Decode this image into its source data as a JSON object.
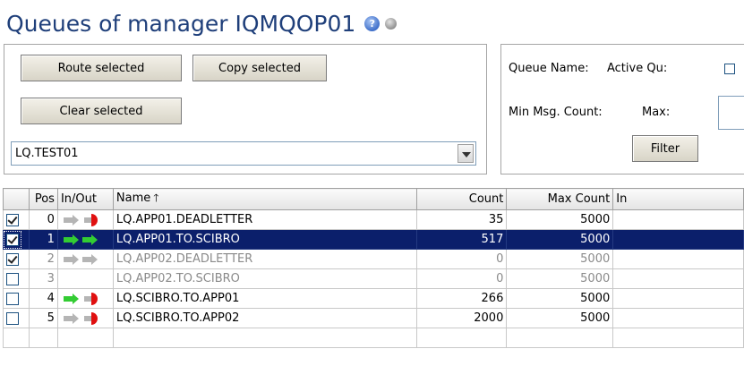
{
  "header": {
    "title": "Queues of manager IQMQOP01",
    "help_icon": "help-icon",
    "status_icon": "status-dot-icon"
  },
  "actions": {
    "route_label": "Route selected",
    "copy_label": "Copy selected",
    "clear_label": "Clear selected",
    "target_queue": "LQ.TEST01"
  },
  "filter": {
    "queue_name_label": "Queue Name:",
    "active_label": "Active Qu:",
    "min_count_label": "Min Msg. Count:",
    "max_label": "Max:",
    "filter_label": "Filter"
  },
  "table": {
    "columns": {
      "check": "",
      "pos": "Pos",
      "inout": "In/Out",
      "name": "Name",
      "count": "Count",
      "max_count": "Max Count",
      "extra": "In"
    },
    "rows": [
      {
        "checked": true,
        "pos": "0",
        "in_arrow": "gray",
        "out_arrow": "red",
        "name": "LQ.APP01.DEADLETTER",
        "count": "35",
        "max_count": "5000",
        "selected": false,
        "dim": false
      },
      {
        "checked": true,
        "pos": "1",
        "in_arrow": "green",
        "out_arrow": "green",
        "name": "LQ.APP01.TO.SCIBRO",
        "count": "517",
        "max_count": "5000",
        "selected": true,
        "dim": false
      },
      {
        "checked": true,
        "pos": "2",
        "in_arrow": "gray",
        "out_arrow": "gray",
        "name": "LQ.APP02.DEADLETTER",
        "count": "0",
        "max_count": "5000",
        "selected": false,
        "dim": true
      },
      {
        "checked": false,
        "pos": "3",
        "in_arrow": "none",
        "out_arrow": "none",
        "name": "LQ.APP02.TO.SCIBRO",
        "count": "0",
        "max_count": "5000",
        "selected": false,
        "dim": true
      },
      {
        "checked": false,
        "pos": "4",
        "in_arrow": "green",
        "out_arrow": "red",
        "name": "LQ.SCIBRO.TO.APP01",
        "count": "266",
        "max_count": "5000",
        "selected": false,
        "dim": false
      },
      {
        "checked": false,
        "pos": "5",
        "in_arrow": "gray",
        "out_arrow": "red",
        "name": "LQ.SCIBRO.TO.APP02",
        "count": "2000",
        "max_count": "5000",
        "selected": false,
        "dim": false
      }
    ]
  },
  "colors": {
    "selected_row": "#0b1f6b",
    "title": "#1f3f7a",
    "arrow_green": "#33cc33",
    "arrow_gray": "#b5b5b5",
    "arrow_red": "#e01010"
  }
}
